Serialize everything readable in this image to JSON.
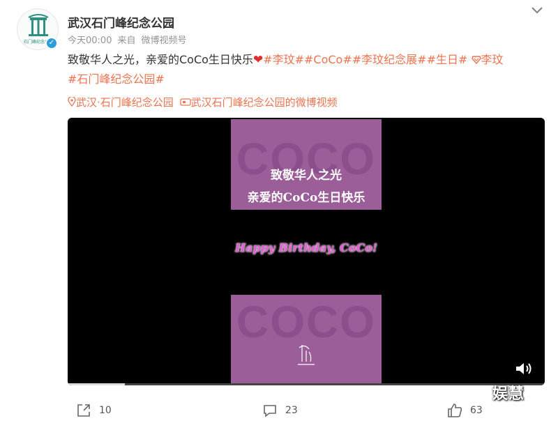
{
  "account": {
    "name": "武汉石门峰纪念公园",
    "avatar_text": "石门峰纪念公园",
    "verified": true
  },
  "meta": {
    "time": "今天00:00",
    "source_prefix": "来自",
    "source": "微博视频号"
  },
  "post": {
    "text": "致敬华人之光，亲爱的CoCo生日快乐",
    "heart": "❤",
    "tags_line1": [
      "#李玟#",
      "#CoCo#",
      "#李玟纪念展#",
      "#生日#"
    ],
    "mention": "李玟",
    "tags_line2": [
      "#石门峰纪念公园#"
    ]
  },
  "location": {
    "place": "武汉·石门峰纪念公园",
    "video_link": "武汉石门峰纪念公园的微博视频"
  },
  "video": {
    "watermark_text": "COCO",
    "line1": "致敬华人之光",
    "line2": "亲爱的CoCo生日快乐",
    "greeting": "Happy Birthday, CoCo!",
    "progress": 0.12
  },
  "footer": {
    "repost_count": "10",
    "comment_count": "23",
    "like_count": "63"
  },
  "overlay": {
    "watermark": "娱慧"
  },
  "colors": {
    "tag": "#eb7350",
    "panel": "#9b5e99",
    "greeting": "#e85ad6"
  },
  "icons": [
    "verified-icon",
    "more-chevron-icon",
    "location-pin-icon",
    "video-link-icon",
    "volume-icon",
    "repost-icon",
    "comment-icon",
    "like-icon",
    "super-topic-icon"
  ]
}
